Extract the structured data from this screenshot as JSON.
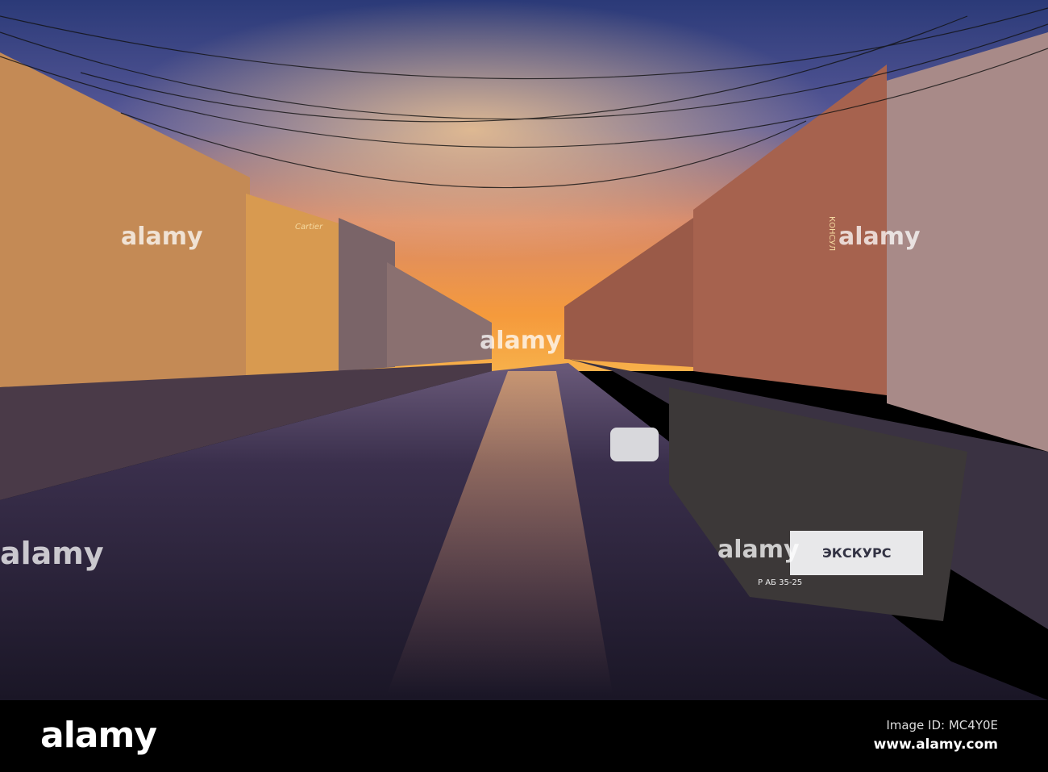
{
  "photo": {
    "signs": {
      "shop_left": "Cartier",
      "hotel_right": "КОНСУЛ",
      "boat_banner": "ЭКСКУРС",
      "boat_reg": "Р АБ 35-25"
    }
  },
  "watermark": {
    "text": "alamy"
  },
  "footer": {
    "logo": "alamy",
    "image_id": "Image ID: MC4Y0E",
    "site": "www.alamy.com"
  },
  "colors": {
    "sky_top": "#2e3f7a",
    "sunset": "#f59a3c",
    "water": "#1e1a2c"
  }
}
